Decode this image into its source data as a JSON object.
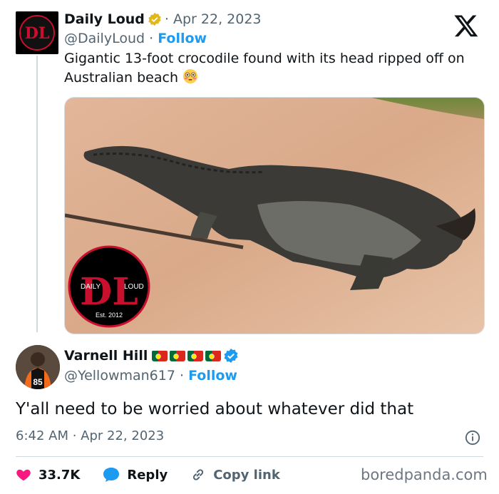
{
  "quoted_tweet": {
    "name": "Daily Loud",
    "date": "Apr 22, 2023",
    "handle": "@DailyLoud",
    "follow_label": "Follow",
    "text": "Gigantic 13-foot crocodile found with its head ripped off on Australian beach",
    "avatar_logo": {
      "left": "DAILY",
      "right": "LOUD",
      "bottom": "Est. 2012",
      "letters": "DL"
    },
    "media_watermark": {
      "left": "DAILY",
      "right": "LOUD",
      "bottom": "Est. 2012",
      "letters": "DL"
    },
    "verified_color": "#e2b719"
  },
  "main_tweet": {
    "name": "Varnell Hill",
    "handle": "@Yellowman617",
    "follow_label": "Follow",
    "text": "Y'all need to be worried about whatever did that",
    "timestamp": "6:42 AM · Apr 22, 2023",
    "flag_count": 4,
    "jersey_number": "85",
    "verified_color": "#1d9bf0"
  },
  "actions": {
    "likes": "33.7K",
    "reply_label": "Reply",
    "copy_link_label": "Copy link"
  },
  "brand": "boredpanda.com",
  "colors": {
    "like": "#f91880",
    "accent": "#1d9bf0",
    "muted": "#536471",
    "dl_red": "#c8102e"
  },
  "icons": [
    "x-logo-icon",
    "verified-gold-icon",
    "verified-blue-icon",
    "flushed-face-emoji",
    "portugal-flag-icon",
    "info-icon",
    "heart-icon",
    "reply-icon",
    "link-icon"
  ]
}
